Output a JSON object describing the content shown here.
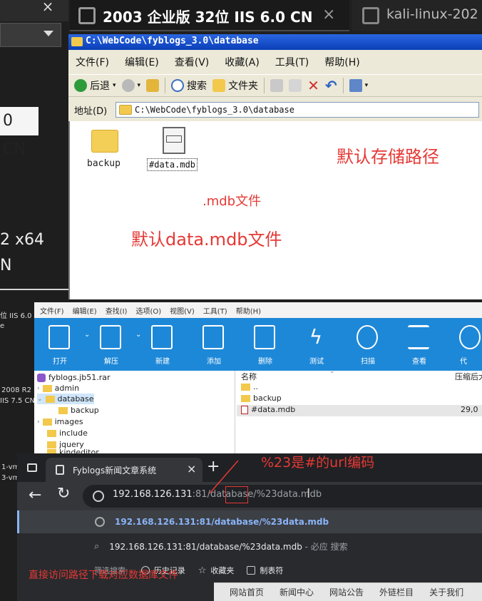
{
  "left_panel": {
    "close_glyph": "×",
    "partial_cn": "0 CN",
    "partial_x64": "2 x64",
    "partial_n": "N"
  },
  "vm_tabs": [
    {
      "title": "2003 企业版 32位 IIS 6.0 CN",
      "close": "×"
    },
    {
      "title": "kali-linux-202"
    }
  ],
  "explorer": {
    "title": "C:\\WebCode\\fyblogs_3.0\\database",
    "menu": [
      "文件(F)",
      "编辑(E)",
      "查看(V)",
      "收藏(A)",
      "工具(T)",
      "帮助(H)"
    ],
    "toolbar": {
      "back": "后退",
      "search": "搜索",
      "folders": "文件夹"
    },
    "address_label": "地址(D)",
    "address_value": "C:\\WebCode\\fyblogs_3.0\\database",
    "files": [
      {
        "name": "backup",
        "icon": "folder-icon"
      },
      {
        "name": "#data.mdb",
        "icon": "database-file-icon"
      }
    ],
    "annotations": {
      "path": "默认存储路径",
      "mdb": ".mdb文件",
      "default": "默认data.mdb文件"
    }
  },
  "bandizip": {
    "menu": [
      "文件(F)",
      "编辑(E)",
      "查找(I)",
      "选项(O)",
      "视图(V)",
      "工具(T)",
      "帮助(H)"
    ],
    "toolbar": [
      "打开",
      "解压",
      "新建",
      "添加",
      "删除",
      "测试",
      "扫描",
      "查看",
      "代"
    ],
    "tree": [
      {
        "name": "fyblogs.jb51.rar",
        "level": 0
      },
      {
        "name": "admin",
        "level": 1
      },
      {
        "name": "database",
        "level": 1,
        "selected": true
      },
      {
        "name": "backup",
        "level": 2
      },
      {
        "name": "images",
        "level": 1
      },
      {
        "name": "include",
        "level": 1
      },
      {
        "name": "jquery",
        "level": 1
      },
      {
        "name": "kindeditor",
        "level": 1
      }
    ],
    "columns": {
      "name": "名称",
      "compressed": "压缩后大"
    },
    "list": [
      {
        "name": "..",
        "size": ""
      },
      {
        "name": "backup",
        "size": ""
      },
      {
        "name": "#data.mdb",
        "size": "29,0"
      }
    ]
  },
  "left_partial_labels": [
    "位 IIS 6.0 C",
    "e",
    "2008 R2",
    "IIS 7.5 CN",
    "1-vm",
    "3-vm"
  ],
  "browser": {
    "tab_title": "Fyblogs新闻文章系统",
    "tab_close": "×",
    "new_tab": "+",
    "back": "←",
    "reload": "↻",
    "url_host": "192.168.126.131",
    "url_rest": ":81/database/%23data.mdb",
    "cursor": "I",
    "suggestions": [
      {
        "text": "192.168.126.131:81/database/%23data.mdb"
      },
      {
        "text": "192.168.126.131:81/database/%23data.mdb",
        "suffix": " - 必应 搜索"
      }
    ],
    "search_with": "筛选搜索:",
    "chips": [
      "历史记录",
      "收藏夹",
      "制表符"
    ],
    "site_nav": [
      "网站首页",
      "新闻中心",
      "网站公告",
      "外链栏目",
      "关于我们"
    ],
    "search_glyph": "⌕"
  },
  "annotations": {
    "url_encode": "%23是#的url编码",
    "direct": "直接访问路径下载对应数据库文件"
  },
  "colors": {
    "annotation": "#e53935",
    "bandizip": "#1e88d8",
    "xp_title": "#0a3fb8"
  }
}
